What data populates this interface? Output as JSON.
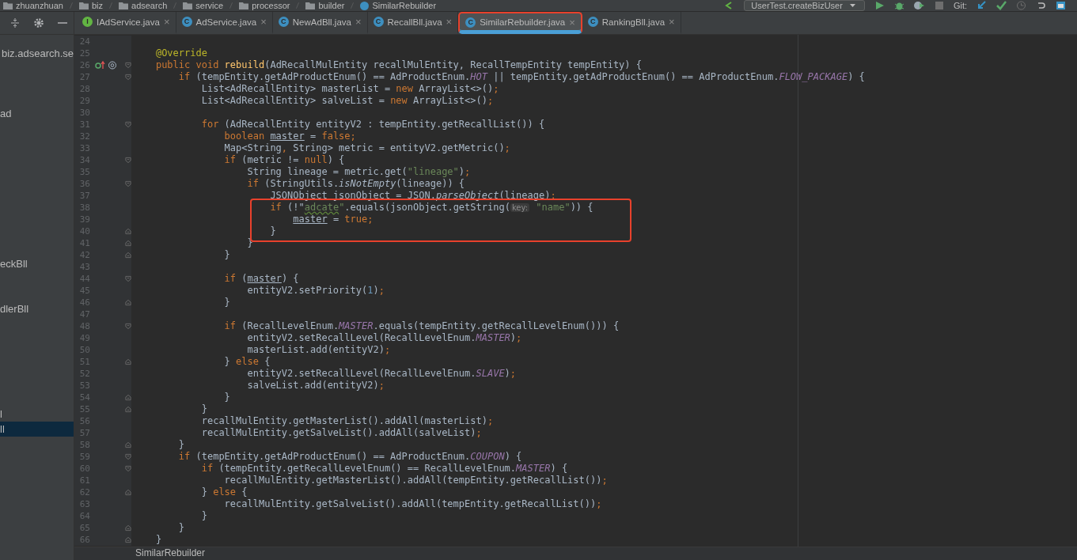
{
  "navigation_bar": {
    "breadcrumbs": [
      "zhuanzhuan",
      "biz",
      "adsearch",
      "service",
      "processor",
      "builder",
      "SimilarRebuilder"
    ],
    "run_configuration": "UserTest.createBizUser",
    "vcs_label": "Git:"
  },
  "project_panel": {
    "items": [
      {
        "label": "biz.adsearch.se",
        "selected": false
      },
      {
        "label": "ad",
        "selected": false
      },
      {
        "label": "eckBll",
        "selected": false
      },
      {
        "label": "dlerBll",
        "selected": false
      },
      {
        "label": "l",
        "selected": false
      },
      {
        "label": "ll",
        "selected": true
      }
    ]
  },
  "tabs": [
    {
      "label": "IAdService.java",
      "kind": "interface",
      "badge": "I",
      "close": "×",
      "selected": false,
      "boxed": false
    },
    {
      "label": "AdService.java",
      "kind": "class",
      "badge": "C",
      "close": "×",
      "selected": false,
      "boxed": false
    },
    {
      "label": "NewAdBll.java",
      "kind": "class",
      "badge": "C",
      "close": "×",
      "selected": false,
      "boxed": false
    },
    {
      "label": "RecallBll.java",
      "kind": "class",
      "badge": "C",
      "close": "×",
      "selected": false,
      "boxed": false
    },
    {
      "label": "SimilarRebuilder.java",
      "kind": "class",
      "badge": "C",
      "close": "×",
      "selected": true,
      "boxed": true
    },
    {
      "label": "RankingBll.java",
      "kind": "class",
      "badge": "C",
      "close": "×",
      "selected": false,
      "boxed": false
    }
  ],
  "editor": {
    "lines": [
      {
        "number": "24",
        "boxed": false
      },
      {
        "number": "25",
        "boxed": false,
        "tokens": [
          {
            "kind": "ann",
            "text": "    @Override"
          }
        ]
      },
      {
        "number": "26",
        "boxed": false,
        "override": true,
        "fold_open": true,
        "tokens": [
          {
            "kind": "kw",
            "text": "    public void "
          },
          {
            "kind": "method",
            "text": "rebuild"
          },
          {
            "kind": "plain",
            "text": "(AdRecallMulEntity recallMulEntity, RecallTempEntity tempEntity) {"
          }
        ]
      },
      {
        "number": "27",
        "boxed": false,
        "fold_open": true,
        "tokens": [
          {
            "kind": "kw",
            "text": "        if "
          },
          {
            "kind": "plain",
            "text": "(tempEntity.getAdProductEnum() == AdProductEnum."
          },
          {
            "kind": "const",
            "text": "HOT"
          },
          {
            "kind": "plain",
            "text": " || tempEntity.getAdProductEnum() == AdProductEnum."
          },
          {
            "kind": "const",
            "text": "FLOW_PACKAGE"
          },
          {
            "kind": "plain",
            "text": ") {"
          }
        ]
      },
      {
        "number": "28",
        "boxed": false,
        "tokens": [
          {
            "kind": "plain",
            "text": "            List<AdRecallEntity> masterList = "
          },
          {
            "kind": "kw",
            "text": "new "
          },
          {
            "kind": "plain",
            "text": "ArrayList<>()"
          },
          {
            "kind": "kw",
            "text": ";"
          }
        ]
      },
      {
        "number": "29",
        "boxed": false,
        "tokens": [
          {
            "kind": "plain",
            "text": "            List<AdRecallEntity> salveList = "
          },
          {
            "kind": "kw",
            "text": "new "
          },
          {
            "kind": "plain",
            "text": "ArrayList<>()"
          },
          {
            "kind": "kw",
            "text": ";"
          }
        ]
      },
      {
        "number": "30",
        "boxed": false
      },
      {
        "number": "31",
        "boxed": false,
        "fold_open": true,
        "tokens": [
          {
            "kind": "kw",
            "text": "            for "
          },
          {
            "kind": "plain",
            "text": "(AdRecallEntity entityV2 : tempEntity.getRecallList()) {"
          }
        ]
      },
      {
        "number": "32",
        "boxed": false,
        "tokens": [
          {
            "kind": "kw",
            "text": "                boolean "
          },
          {
            "kind": "field",
            "text": "master"
          },
          {
            "kind": "plain",
            "text": " = "
          },
          {
            "kind": "kw",
            "text": "false;"
          }
        ]
      },
      {
        "number": "33",
        "boxed": false,
        "tokens": [
          {
            "kind": "plain",
            "text": "                Map<String"
          },
          {
            "kind": "kw",
            "text": ", "
          },
          {
            "kind": "plain",
            "text": "String> metric = entityV2.getMetric()"
          },
          {
            "kind": "kw",
            "text": ";"
          }
        ]
      },
      {
        "number": "34",
        "boxed": false,
        "fold_open": true,
        "tokens": [
          {
            "kind": "kw",
            "text": "                if "
          },
          {
            "kind": "plain",
            "text": "(metric != "
          },
          {
            "kind": "kw",
            "text": "null"
          },
          {
            "kind": "plain",
            "text": ") {"
          }
        ]
      },
      {
        "number": "35",
        "boxed": false,
        "tokens": [
          {
            "kind": "plain",
            "text": "                    String lineage = metric.get("
          },
          {
            "kind": "str",
            "text": "\"lineage\""
          },
          {
            "kind": "plain",
            "text": ")"
          },
          {
            "kind": "kw",
            "text": ";"
          }
        ]
      },
      {
        "number": "36",
        "boxed": false,
        "fold_open": true,
        "tokens": [
          {
            "kind": "kw",
            "text": "                    if "
          },
          {
            "kind": "plain",
            "text": "(StringUtils."
          },
          {
            "kind": "static",
            "text": "isNotEmpty"
          },
          {
            "kind": "plain",
            "text": "(lineage)) {"
          }
        ]
      },
      {
        "number": "37",
        "boxed": false,
        "tokens": [
          {
            "kind": "plain",
            "text": "                        JSONObject jsonObject = JSON."
          },
          {
            "kind": "static",
            "text": "parseObject"
          },
          {
            "kind": "plain",
            "text": "(lineage)"
          },
          {
            "kind": "kw",
            "text": ";"
          }
        ]
      },
      {
        "number": "38",
        "boxed": true,
        "tokens": [
          {
            "kind": "kw",
            "text": "                        if "
          },
          {
            "kind": "plain",
            "text": "(!\""
          },
          {
            "kind": "str_warn",
            "text": "adcate"
          },
          {
            "kind": "str",
            "text": "\""
          },
          {
            "kind": "plain",
            "text": ".equals(jsonObject.getString("
          },
          {
            "kind": "hint",
            "text": "key:"
          },
          {
            "kind": "str",
            "text": " \"name\""
          },
          {
            "kind": "plain",
            "text": ")) {"
          }
        ]
      },
      {
        "number": "39",
        "boxed": true,
        "tokens": [
          {
            "kind": "field",
            "text": "                            master"
          },
          {
            "kind": "plain",
            "text": " = "
          },
          {
            "kind": "kw",
            "text": "true;"
          }
        ]
      },
      {
        "number": "40",
        "boxed": true,
        "fold_close": true,
        "tokens": [
          {
            "kind": "plain",
            "text": "                        }"
          }
        ]
      },
      {
        "number": "41",
        "boxed": false,
        "fold_close": true,
        "tokens": [
          {
            "kind": "plain",
            "text": "                    }"
          }
        ]
      },
      {
        "number": "42",
        "boxed": false,
        "fold_close": true,
        "tokens": [
          {
            "kind": "plain",
            "text": "                }"
          }
        ]
      },
      {
        "number": "43",
        "boxed": false
      },
      {
        "number": "44",
        "boxed": false,
        "fold_open": true,
        "tokens": [
          {
            "kind": "kw",
            "text": "                if "
          },
          {
            "kind": "plain",
            "text": "("
          },
          {
            "kind": "field",
            "text": "master"
          },
          {
            "kind": "plain",
            "text": ") {"
          }
        ]
      },
      {
        "number": "45",
        "boxed": false,
        "tokens": [
          {
            "kind": "plain",
            "text": "                    entityV2.setPriority("
          },
          {
            "kind": "num",
            "text": "1"
          },
          {
            "kind": "plain",
            "text": ")"
          },
          {
            "kind": "kw",
            "text": ";"
          }
        ]
      },
      {
        "number": "46",
        "boxed": false,
        "fold_close": true,
        "tokens": [
          {
            "kind": "plain",
            "text": "                }"
          }
        ]
      },
      {
        "number": "47",
        "boxed": false
      },
      {
        "number": "48",
        "boxed": false,
        "fold_open": true,
        "tokens": [
          {
            "kind": "kw",
            "text": "                if "
          },
          {
            "kind": "plain",
            "text": "(RecallLevelEnum."
          },
          {
            "kind": "const",
            "text": "MASTER"
          },
          {
            "kind": "plain",
            "text": ".equals(tempEntity.getRecallLevelEnum())) {"
          }
        ]
      },
      {
        "number": "49",
        "boxed": false,
        "tokens": [
          {
            "kind": "plain",
            "text": "                    entityV2.setRecallLevel(RecallLevelEnum."
          },
          {
            "kind": "const",
            "text": "MASTER"
          },
          {
            "kind": "plain",
            "text": ")"
          },
          {
            "kind": "kw",
            "text": ";"
          }
        ]
      },
      {
        "number": "50",
        "boxed": false,
        "tokens": [
          {
            "kind": "plain",
            "text": "                    masterList.add(entityV2)"
          },
          {
            "kind": "kw",
            "text": ";"
          }
        ]
      },
      {
        "number": "51",
        "boxed": false,
        "fold_close": true,
        "tokens": [
          {
            "kind": "plain",
            "text": "                } "
          },
          {
            "kind": "kw",
            "text": "else "
          },
          {
            "kind": "plain",
            "text": "{"
          }
        ]
      },
      {
        "number": "52",
        "boxed": false,
        "tokens": [
          {
            "kind": "plain",
            "text": "                    entityV2.setRecallLevel(RecallLevelEnum."
          },
          {
            "kind": "const",
            "text": "SLAVE"
          },
          {
            "kind": "plain",
            "text": ")"
          },
          {
            "kind": "kw",
            "text": ";"
          }
        ]
      },
      {
        "number": "53",
        "boxed": false,
        "tokens": [
          {
            "kind": "plain",
            "text": "                    salveList.add(entityV2)"
          },
          {
            "kind": "kw",
            "text": ";"
          }
        ]
      },
      {
        "number": "54",
        "boxed": false,
        "fold_close": true,
        "tokens": [
          {
            "kind": "plain",
            "text": "                }"
          }
        ]
      },
      {
        "number": "55",
        "boxed": false,
        "fold_close": true,
        "tokens": [
          {
            "kind": "plain",
            "text": "            }"
          }
        ]
      },
      {
        "number": "56",
        "boxed": false,
        "tokens": [
          {
            "kind": "plain",
            "text": "            recallMulEntity.getMasterList().addAll(masterList)"
          },
          {
            "kind": "kw",
            "text": ";"
          }
        ]
      },
      {
        "number": "57",
        "boxed": false,
        "tokens": [
          {
            "kind": "plain",
            "text": "            recallMulEntity.getSalveList().addAll(salveList)"
          },
          {
            "kind": "kw",
            "text": ";"
          }
        ]
      },
      {
        "number": "58",
        "boxed": false,
        "fold_close": true,
        "tokens": [
          {
            "kind": "plain",
            "text": "        }"
          }
        ]
      },
      {
        "number": "59",
        "boxed": false,
        "fold_open": true,
        "tokens": [
          {
            "kind": "kw",
            "text": "        if "
          },
          {
            "kind": "plain",
            "text": "(tempEntity.getAdProductEnum() == AdProductEnum."
          },
          {
            "kind": "const",
            "text": "COUPON"
          },
          {
            "kind": "plain",
            "text": ") {"
          }
        ]
      },
      {
        "number": "60",
        "boxed": false,
        "fold_open": true,
        "tokens": [
          {
            "kind": "kw",
            "text": "            if "
          },
          {
            "kind": "plain",
            "text": "(tempEntity.getRecallLevelEnum() == RecallLevelEnum."
          },
          {
            "kind": "const",
            "text": "MASTER"
          },
          {
            "kind": "plain",
            "text": ") {"
          }
        ]
      },
      {
        "number": "61",
        "boxed": false,
        "tokens": [
          {
            "kind": "plain",
            "text": "                recallMulEntity.getMasterList().addAll(tempEntity.getRecallList())"
          },
          {
            "kind": "kw",
            "text": ";"
          }
        ]
      },
      {
        "number": "62",
        "boxed": false,
        "fold_close": true,
        "tokens": [
          {
            "kind": "plain",
            "text": "            } "
          },
          {
            "kind": "kw",
            "text": "else "
          },
          {
            "kind": "plain",
            "text": "{"
          }
        ]
      },
      {
        "number": "63",
        "boxed": false,
        "tokens": [
          {
            "kind": "plain",
            "text": "                recallMulEntity.getSalveList().addAll(tempEntity.getRecallList())"
          },
          {
            "kind": "kw",
            "text": ";"
          }
        ]
      },
      {
        "number": "64",
        "boxed": false,
        "tokens": [
          {
            "kind": "plain",
            "text": "            }"
          }
        ]
      },
      {
        "number": "65",
        "boxed": false,
        "fold_close": true,
        "tokens": [
          {
            "kind": "plain",
            "text": "        }"
          }
        ]
      },
      {
        "number": "66",
        "boxed": false,
        "fold_close": true,
        "tokens": [
          {
            "kind": "plain",
            "text": "    }"
          }
        ]
      }
    ]
  },
  "editor_breadcrumb": "SimilarRebuilder"
}
